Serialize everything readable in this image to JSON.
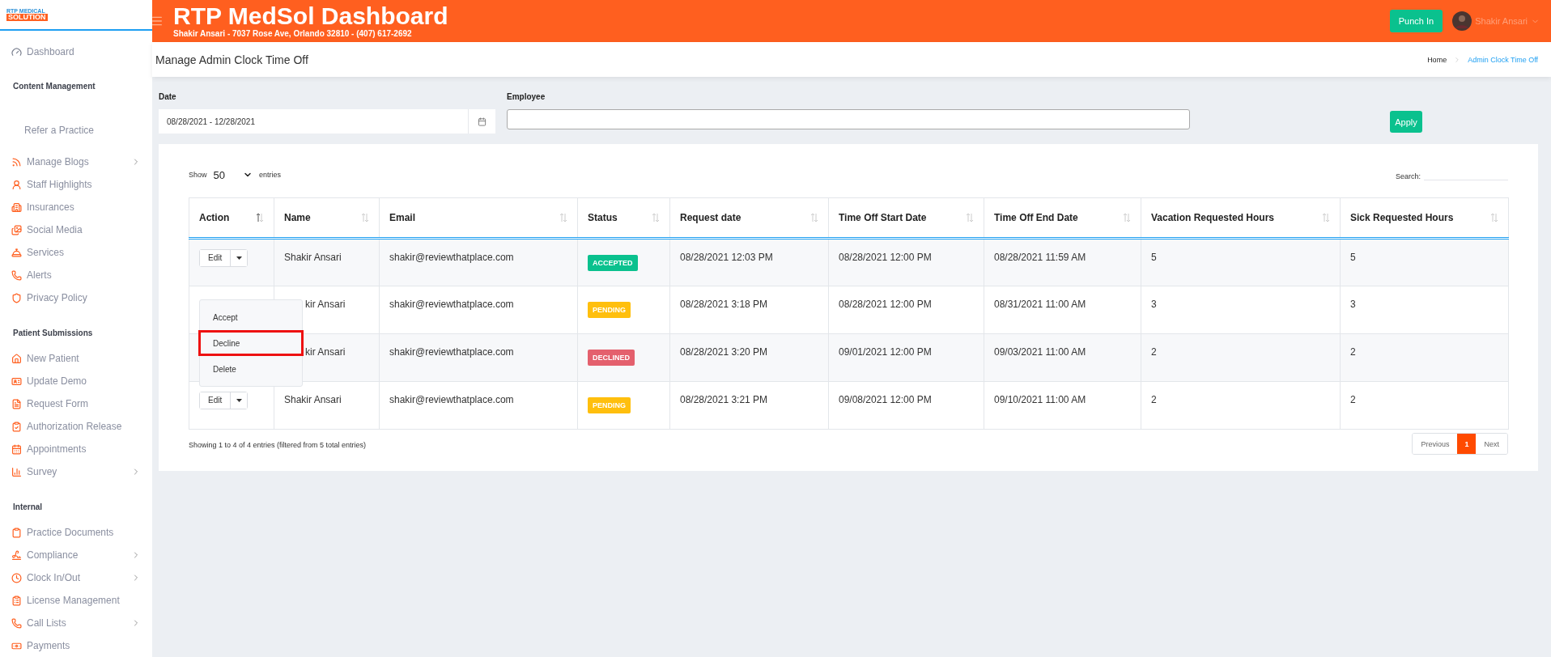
{
  "logo": {
    "line_1": "RTP MEDICAL",
    "line_2": "SOLUTION"
  },
  "header": {
    "title": "RTP MedSol Dashboard",
    "subtitle": "Shakir Ansari - 7037 Rose Ave, Orlando 32810 - (407) 617-2692",
    "punch_button": "Punch In",
    "user_name": "Shakir Ansari"
  },
  "sidebar": {
    "items": [
      {
        "kind": "top",
        "label": "Dashboard",
        "has_submenu": false
      },
      {
        "kind": "header",
        "label": "Content Management"
      },
      {
        "kind": "plain",
        "label": "Refer a Practice",
        "has_submenu": false
      },
      {
        "kind": "link",
        "label": "Manage Blogs",
        "has_submenu": true
      },
      {
        "kind": "link",
        "label": "Staff Highlights",
        "has_submenu": false
      },
      {
        "kind": "link",
        "label": "Insurances",
        "has_submenu": false
      },
      {
        "kind": "link",
        "label": "Social Media",
        "has_submenu": false
      },
      {
        "kind": "link",
        "label": "Services",
        "has_submenu": false
      },
      {
        "kind": "link",
        "label": "Alerts",
        "has_submenu": false
      },
      {
        "kind": "link",
        "label": "Privacy Policy",
        "has_submenu": false
      },
      {
        "kind": "header",
        "label": "Patient Submissions"
      },
      {
        "kind": "link",
        "label": "New Patient",
        "has_submenu": false
      },
      {
        "kind": "link",
        "label": "Update Demo",
        "has_submenu": false
      },
      {
        "kind": "link",
        "label": "Request Form",
        "has_submenu": false
      },
      {
        "kind": "link",
        "label": "Authorization Release",
        "has_submenu": false
      },
      {
        "kind": "link",
        "label": "Appointments",
        "has_submenu": false
      },
      {
        "kind": "link",
        "label": "Survey",
        "has_submenu": true
      },
      {
        "kind": "header",
        "label": "Internal"
      },
      {
        "kind": "link",
        "label": "Practice Documents",
        "has_submenu": false
      },
      {
        "kind": "link",
        "label": "Compliance",
        "has_submenu": true
      },
      {
        "kind": "link",
        "label": "Clock In/Out",
        "has_submenu": true
      },
      {
        "kind": "link",
        "label": "License Management",
        "has_submenu": false
      },
      {
        "kind": "link",
        "label": "Call Lists",
        "has_submenu": true
      },
      {
        "kind": "link",
        "label": "Payments",
        "has_submenu": false
      }
    ]
  },
  "page_title": "Manage Admin Clock Time Off",
  "breadcrumb": [
    {
      "label": "Home",
      "selected": false
    },
    {
      "label": "Admin Clock Time Off",
      "selected": true
    }
  ],
  "filters": {
    "date_label": "Date",
    "date_value": "08/28/2021 - 12/28/2021",
    "employee_label": "Employee",
    "apply_button": "Apply"
  },
  "table_controls": {
    "show_label": "Show",
    "page_size": "50",
    "entries_label": "entries",
    "search_label": "Search:"
  },
  "table": {
    "columns": [
      {
        "label": "Action",
        "sorted": true
      },
      {
        "label": "Name",
        "sorted": false
      },
      {
        "label": "Email",
        "sorted": false
      },
      {
        "label": "Status",
        "sorted": false
      },
      {
        "label": "Request date",
        "sorted": false
      },
      {
        "label": "Time Off Start Date",
        "sorted": false
      },
      {
        "label": "Time Off End Date",
        "sorted": false
      },
      {
        "label": "Vacation Requested Hours",
        "sorted": false
      },
      {
        "label": "Sick Requested Hours",
        "sorted": false
      }
    ],
    "rows": [
      {
        "edit_button": "Edit",
        "name": "Shakir Ansari",
        "email": "shakir@reviewthatplace.com",
        "status": {
          "label": "ACCEPTED",
          "color": "#0ac18e"
        },
        "request_date": "08/28/2021 12:03 PM",
        "start": "08/28/2021 12:00 PM",
        "end": "08/28/2021 11:59 AM",
        "vacation": "5",
        "sick": "5"
      },
      {
        "name": "kir Ansari",
        "email": "shakir@reviewthatplace.com",
        "status": {
          "label": "PENDING",
          "color": "#ffbf0d"
        },
        "request_date": "08/28/2021 3:18 PM",
        "start": "08/28/2021 12:00 PM",
        "end": "08/31/2021 11:00 AM",
        "vacation": "3",
        "sick": "3"
      },
      {
        "name": "kir Ansari",
        "email": "shakir@reviewthatplace.com",
        "status": {
          "label": "DECLINED",
          "color": "#e4606d"
        },
        "request_date": "08/28/2021 3:20 PM",
        "start": "09/01/2021 12:00 PM",
        "end": "09/03/2021 11:00 AM",
        "vacation": "2",
        "sick": "2"
      },
      {
        "edit_button": "Edit",
        "name": "Shakir Ansari",
        "email": "shakir@reviewthatplace.com",
        "status": {
          "label": "PENDING",
          "color": "#ffbf0d"
        },
        "request_date": "08/28/2021 3:21 PM",
        "start": "09/08/2021 12:00 PM",
        "end": "09/10/2021 11:00 AM",
        "vacation": "2",
        "sick": "2"
      }
    ],
    "action_menu": [
      {
        "label": "Accept",
        "highlighted": false
      },
      {
        "label": "Decline",
        "highlighted": true
      },
      {
        "label": "Delete",
        "highlighted": false
      }
    ]
  },
  "footer": {
    "info": "Showing 1 to 4 of 4 entries (filtered from 5 total entries)",
    "pagination": [
      {
        "label": "Previous",
        "selected": false
      },
      {
        "label": "1",
        "selected": true
      },
      {
        "label": "Next",
        "selected": false
      }
    ]
  }
}
